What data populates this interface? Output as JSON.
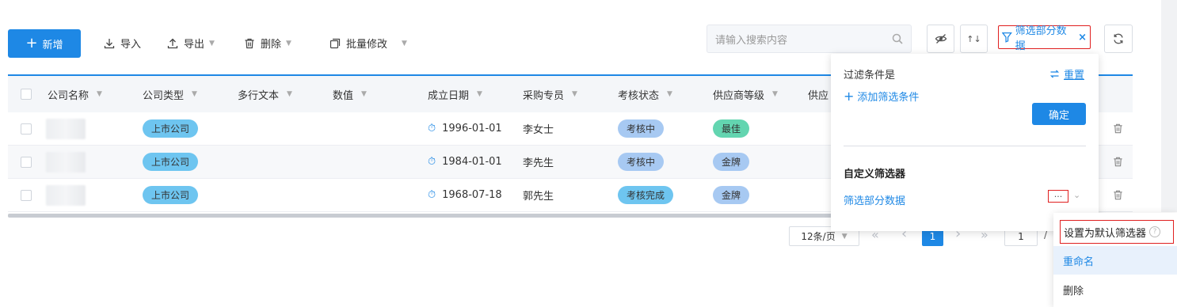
{
  "toolbar": {
    "new_label": "新增",
    "import_label": "导入",
    "export_label": "导出",
    "delete_label": "删除",
    "batch_edit_label": "批量修改",
    "search_placeholder": "请输入搜索内容",
    "filter_chip_label": "筛选部分数据",
    "filter_chip_close": "×"
  },
  "table": {
    "columns": [
      "公司名称",
      "公司类型",
      "多行文本",
      "数值",
      "成立日期",
      "采购专员",
      "考核状态",
      "供应商等级",
      "供应"
    ],
    "rows": [
      {
        "company_type": "上市公司",
        "date": "1996-01-01",
        "buyer": "李女士",
        "status": "考核中",
        "grade": "最佳"
      },
      {
        "company_type": "上市公司",
        "date": "1984-01-01",
        "buyer": "李先生",
        "status": "考核中",
        "grade": "金牌"
      },
      {
        "company_type": "上市公司",
        "date": "1968-07-18",
        "buyer": "郭先生",
        "status": "考核完成",
        "grade": "金牌"
      }
    ]
  },
  "pagination": {
    "page_size": "12条/页",
    "first": "«",
    "prev": "‹",
    "current_page": "1",
    "next": "›",
    "last": "»",
    "goto_value": "1",
    "separator": "/"
  },
  "filter_popover": {
    "condition_title": "过滤条件是",
    "reset_label": "重置",
    "add_condition_label": "添加筛选条件",
    "confirm_label": "确定",
    "custom_title": "自定义筛选器",
    "custom_item_label": "筛选部分数据",
    "more_label": "···"
  },
  "context_menu": {
    "items": [
      "设置为默认筛选器",
      "重命名",
      "删除"
    ]
  },
  "colors": {
    "primary": "#1e88e5",
    "highlight_border": "#e02020",
    "tag_listed": "#6ec5f0",
    "tag_status": "#a7c9f2",
    "tag_grade": "#63d5b0"
  }
}
